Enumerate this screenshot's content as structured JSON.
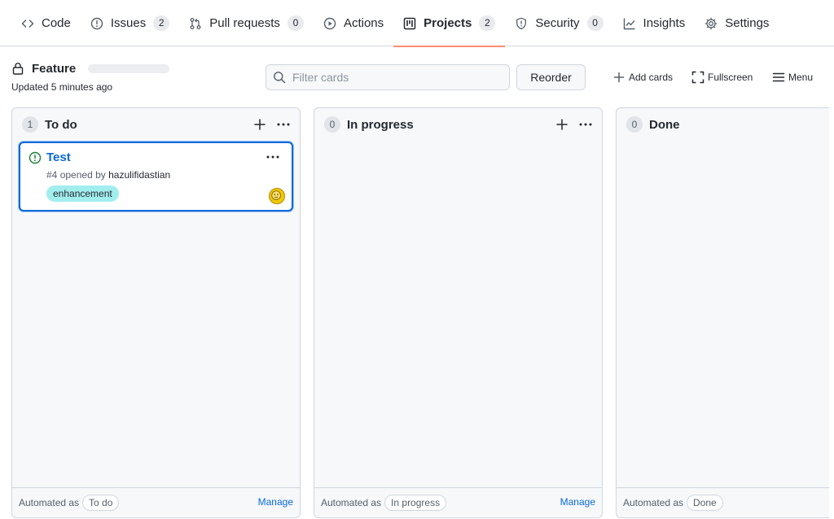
{
  "nav": {
    "tabs": [
      {
        "label": "Code",
        "icon": "code-icon"
      },
      {
        "label": "Issues",
        "icon": "issue-opened-icon",
        "count": "2"
      },
      {
        "label": "Pull requests",
        "icon": "git-pull-request-icon",
        "count": "0"
      },
      {
        "label": "Actions",
        "icon": "play-icon"
      },
      {
        "label": "Projects",
        "icon": "project-icon",
        "count": "2",
        "selected": true
      },
      {
        "label": "Security",
        "icon": "shield-icon",
        "count": "0"
      },
      {
        "label": "Insights",
        "icon": "graph-icon"
      },
      {
        "label": "Settings",
        "icon": "gear-icon"
      }
    ]
  },
  "project": {
    "name": "Feature",
    "updated": "Updated 5 minutes ago",
    "filter_placeholder": "Filter cards",
    "reorder_label": "Reorder",
    "add_cards_label": "Add cards",
    "fullscreen_label": "Fullscreen",
    "menu_label": "Menu"
  },
  "columns": [
    {
      "count": "1",
      "name": "To do",
      "automated_prefix": "Automated as",
      "automated_value": "To do",
      "manage_label": "Manage",
      "cards": [
        {
          "title": "Test",
          "number": "#4",
          "opened_by": "opened by",
          "author": "hazulifidastian",
          "label": "enhancement"
        }
      ]
    },
    {
      "count": "0",
      "name": "In progress",
      "automated_prefix": "Automated as",
      "automated_value": "In progress",
      "manage_label": "Manage"
    },
    {
      "count": "0",
      "name": "Done",
      "automated_prefix": "Automated as",
      "automated_value": "Done"
    }
  ],
  "colors": {
    "accent": "#0969da",
    "selected_tab_underline": "#fd8c73",
    "label_enhancement": "#a2eeef",
    "open_issue": "#1a7f37"
  }
}
